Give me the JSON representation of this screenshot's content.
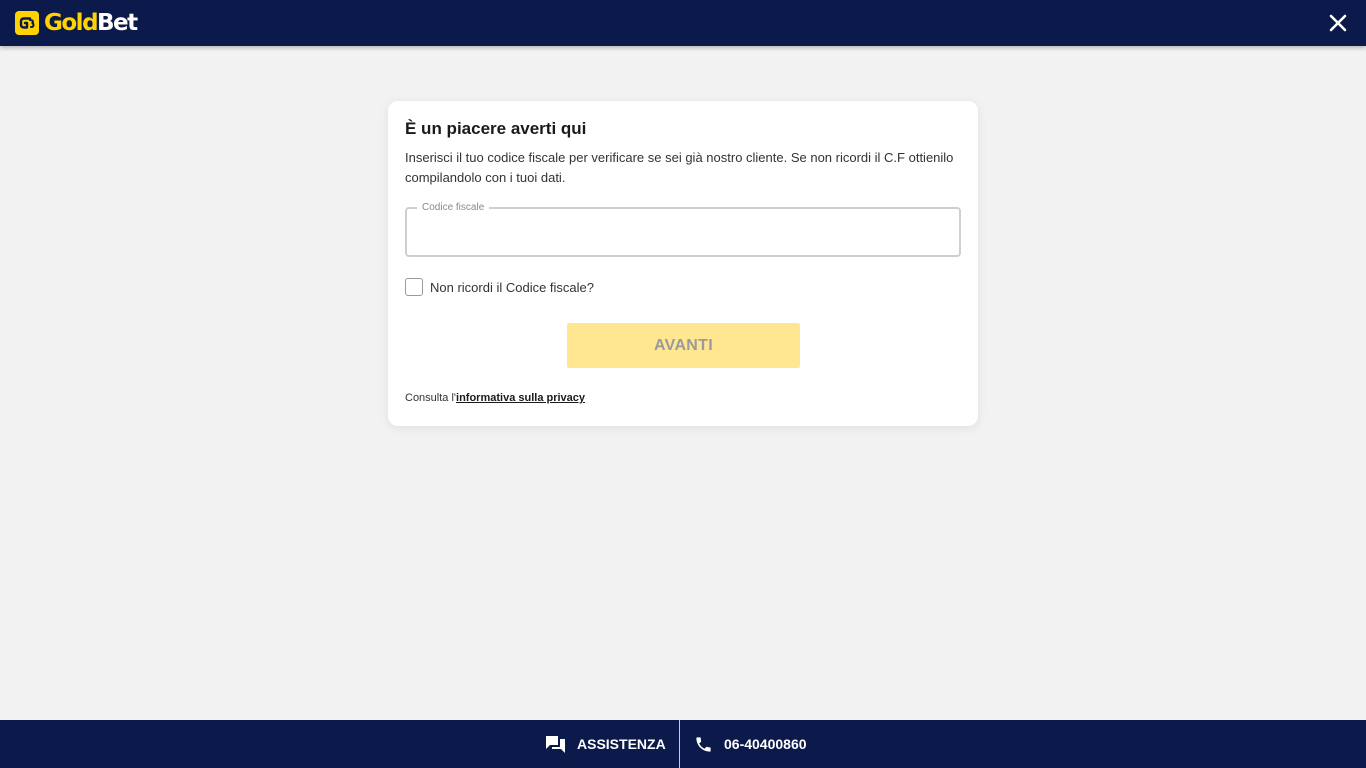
{
  "colors": {
    "navy": "#0b1a4b",
    "brand_yellow": "#ffd200",
    "button_disabled_bg": "#ffe791",
    "page_bg": "#f2f2f2"
  },
  "header": {
    "logo": {
      "part1": "Gold",
      "part2": "Bet",
      "icon": "goldbet-logo-icon"
    },
    "close_icon": "close-icon"
  },
  "card": {
    "title": "È un piacere averti qui",
    "description": "Inserisci il tuo codice fiscale per verificare se sei già nostro cliente. Se non ricordi il C.F ottienilo compilandolo con i tuoi dati.",
    "field": {
      "label": "Codice fiscale",
      "value": ""
    },
    "checkbox": {
      "label": "Non ricordi il Codice fiscale?",
      "checked": false
    },
    "button_label": "AVANTI",
    "privacy": {
      "prefix": "Consulta l'",
      "link": "informativa sulla privacy"
    }
  },
  "footer": {
    "assist": {
      "label": "ASSISTENZA",
      "icon": "chat-icon"
    },
    "phone": {
      "label": "06-40400860",
      "icon": "phone-icon"
    }
  }
}
